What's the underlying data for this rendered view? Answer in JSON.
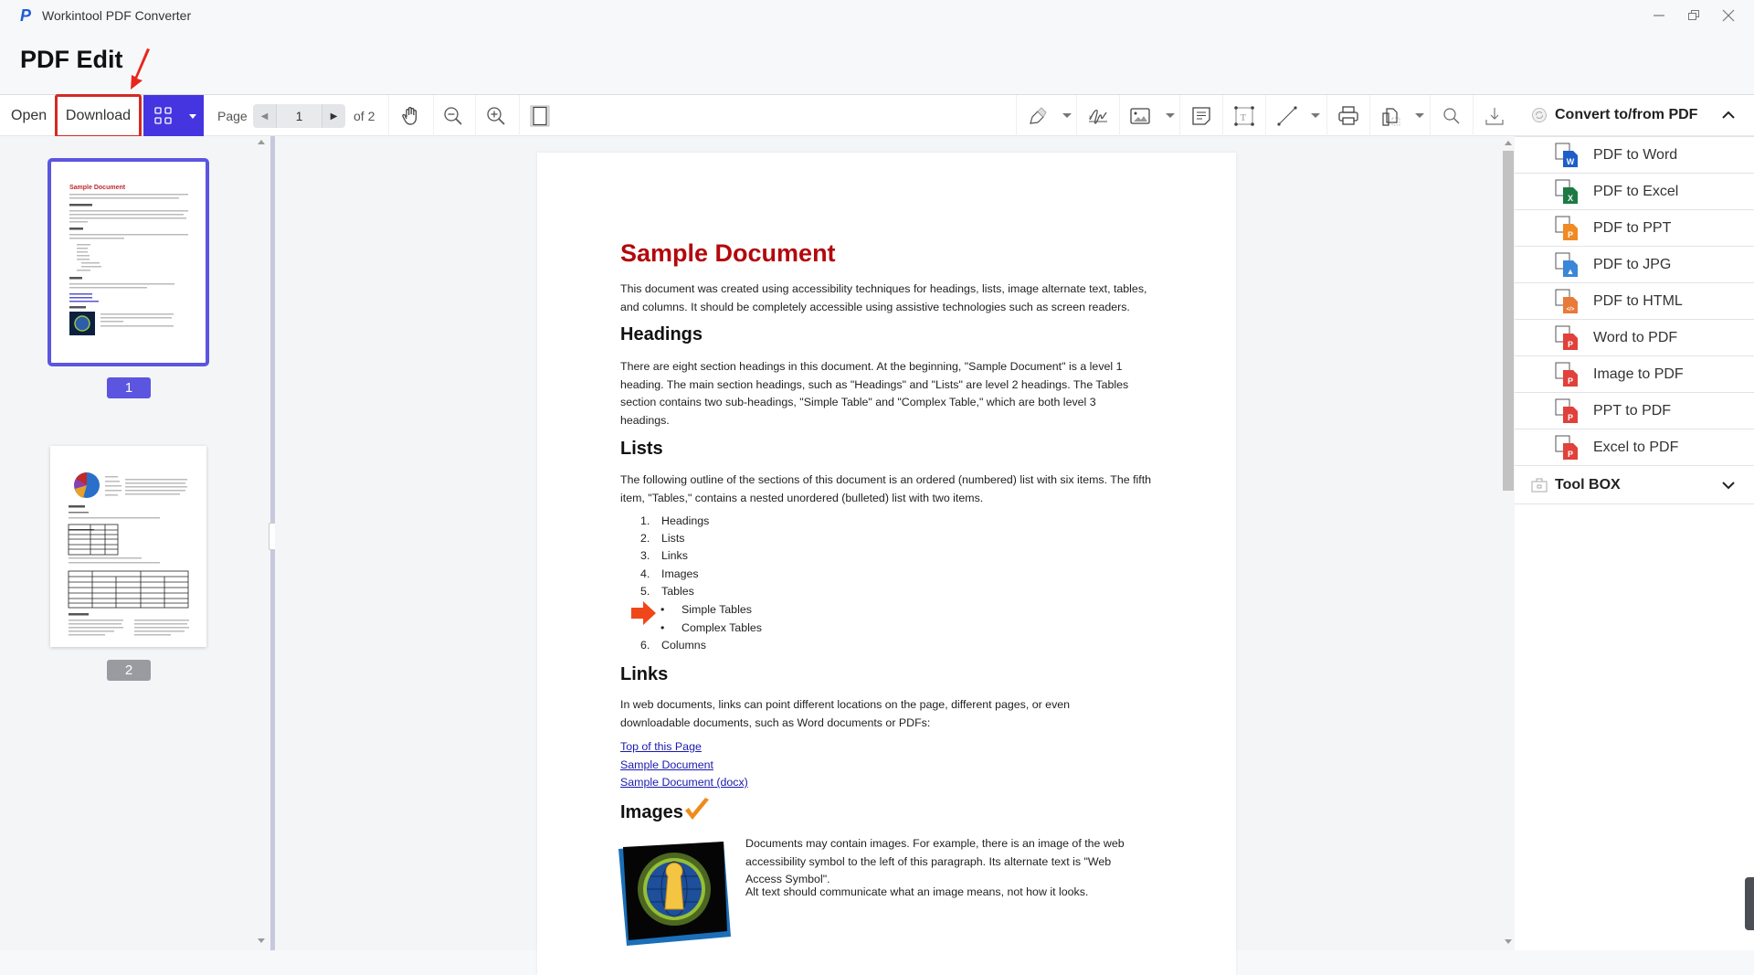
{
  "window": {
    "app_title": "Workintool PDF Converter",
    "controls": [
      "minimize",
      "restore",
      "close"
    ]
  },
  "header": {
    "title": "PDF Edit"
  },
  "toolbar": {
    "open_label": "Open",
    "download_label": "Download",
    "page_label": "Page",
    "current_page": "1",
    "total_pages_label": "of 2",
    "tools": [
      "hand-tool",
      "zoom-out",
      "zoom-in",
      "single-page-view",
      "highlight",
      "signature",
      "insert-image",
      "comment",
      "text-box",
      "line",
      "print",
      "extract-pages",
      "search",
      "save-download"
    ]
  },
  "sidebar": {
    "thumbnails": [
      {
        "page": "1",
        "selected": true,
        "title": "Sample Document"
      },
      {
        "page": "2",
        "selected": false,
        "title": "Tables"
      }
    ]
  },
  "document": {
    "title": "Sample Document",
    "intro": "This document was created using accessibility techniques for headings, lists, image alternate text, tables, and columns. It should be completely accessible using assistive technologies such as screen readers.",
    "sections": {
      "headings": {
        "heading": "Headings",
        "text": "There are eight section headings in this document. At the beginning, \"Sample Document\" is a level 1 heading. The main section headings, such as \"Headings\" and \"Lists\" are level 2 headings. The Tables section contains two sub-headings, \"Simple Table\" and \"Complex Table,\" which are both level 3 headings."
      },
      "lists": {
        "heading": "Lists",
        "text": "The following outline of the sections of this document is an ordered (numbered) list with six items. The fifth item, \"Tables,\" contains a nested unordered (bulleted) list with two items.",
        "ordered": [
          {
            "num": "1.",
            "label": "Headings"
          },
          {
            "num": "2.",
            "label": "Lists"
          },
          {
            "num": "3.",
            "label": "Links"
          },
          {
            "num": "4.",
            "label": "Images"
          },
          {
            "num": "5.",
            "label": "Tables"
          },
          {
            "num": "6.",
            "label": "Columns"
          }
        ],
        "nested": [
          "Simple Tables",
          "Complex Tables"
        ]
      },
      "links": {
        "heading": "Links",
        "text": "In web documents, links can point different locations on the page, different pages, or even downloadable documents, such as Word documents or PDFs:",
        "items": [
          "Top of this Page",
          "Sample Document",
          "Sample Document (docx)"
        ]
      },
      "images": {
        "heading": "Images",
        "text1": "Documents may contain images. For example, there is an image of the web accessibility symbol to the left of this paragraph. Its alternate text is \"Web Access Symbol\".",
        "text2": "Alt text should communicate what an image means, not how it looks."
      }
    }
  },
  "right_panel": {
    "convert_header": "Convert to/from PDF",
    "items": [
      {
        "label": "PDF to Word",
        "icon": "pdf-to-word-icon",
        "color": "#1f5ec9",
        "glyph": "W"
      },
      {
        "label": "PDF to Excel",
        "icon": "pdf-to-excel-icon",
        "color": "#1e7a45",
        "glyph": "X"
      },
      {
        "label": "PDF to PPT",
        "icon": "pdf-to-ppt-icon",
        "color": "#f08a24",
        "glyph": "P"
      },
      {
        "label": "PDF to JPG",
        "icon": "pdf-to-jpg-icon",
        "color": "#3a86d8",
        "glyph": "▲"
      },
      {
        "label": "PDF to HTML",
        "icon": "pdf-to-html-icon",
        "color": "#e87a3a",
        "glyph": "</>"
      },
      {
        "label": "Word to PDF",
        "icon": "word-to-pdf-icon",
        "color": "#e0413a",
        "glyph": "P"
      },
      {
        "label": "Image to PDF",
        "icon": "image-to-pdf-icon",
        "color": "#e0413a",
        "glyph": "P"
      },
      {
        "label": "PPT to PDF",
        "icon": "ppt-to-pdf-icon",
        "color": "#e0413a",
        "glyph": "P"
      },
      {
        "label": "Excel to PDF",
        "icon": "excel-to-pdf-icon",
        "color": "#e0413a",
        "glyph": "P"
      }
    ],
    "toolbox_label": "Tool BOX"
  },
  "colors": {
    "accent": "#4535e0",
    "selection": "#5b55e0",
    "annotation_red": "#d42a22",
    "doc_title_red": "#b3080d",
    "link_blue": "#1a1ab0"
  }
}
